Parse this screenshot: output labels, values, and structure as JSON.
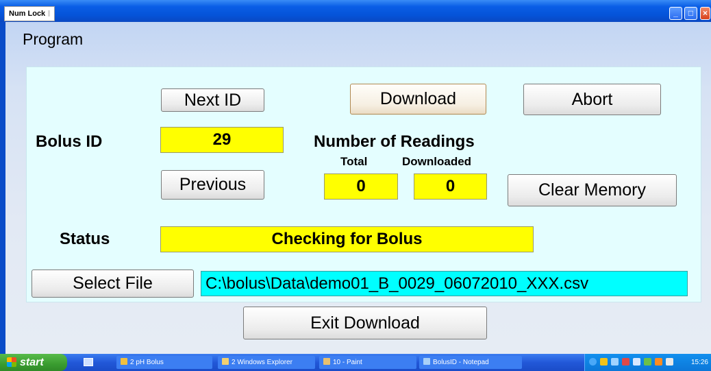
{
  "titlebar": {
    "numlock": "Num Lock"
  },
  "window": {
    "heading": "Program"
  },
  "buttons": {
    "next_id": "Next ID",
    "download": "Download",
    "abort": "Abort",
    "previous": "Previous",
    "clear_memory": "Clear Memory",
    "select_file": "Select File",
    "exit_download": "Exit Download"
  },
  "labels": {
    "bolus_id": "Bolus ID",
    "number_of_readings": "Number of Readings",
    "total": "Total",
    "downloaded": "Downloaded",
    "status": "Status"
  },
  "values": {
    "bolus_id": "29",
    "total": "0",
    "downloaded": "0",
    "status": "Checking for Bolus",
    "file_path": "C:\\bolus\\Data\\demo01_B_0029_06072010_XXX.csv"
  },
  "taskbar": {
    "start": "start",
    "items": [
      "2 pH Bolus",
      "2 Windows Explorer",
      "10 - Paint",
      "BolusID - Notepad"
    ],
    "clock": "15:26"
  },
  "colors": {
    "panel": "#e4feff",
    "field_yellow": "#ffff00",
    "path_cyan": "#00ffff",
    "titlebar": "#0553d8"
  }
}
